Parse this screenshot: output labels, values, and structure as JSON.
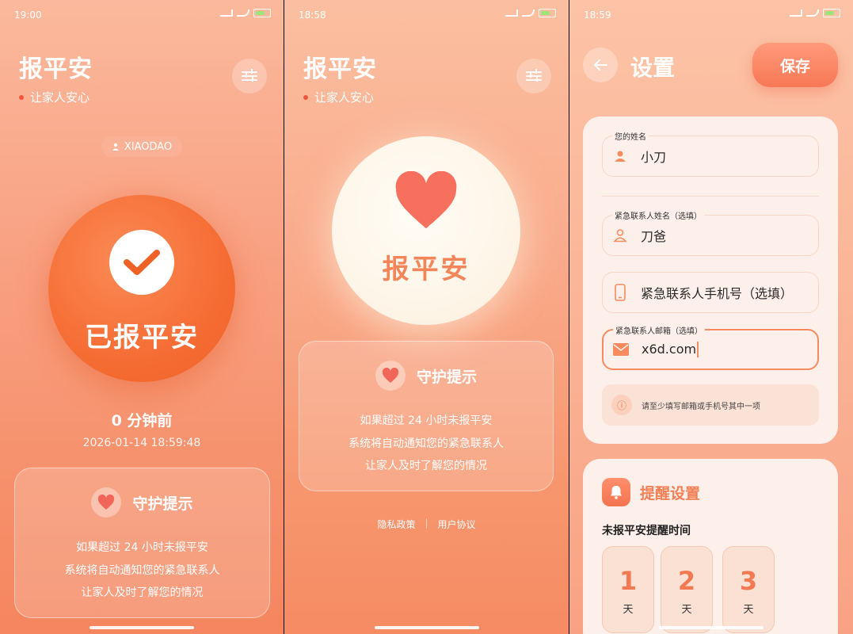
{
  "colors": {
    "accent": "#f56d34",
    "brand_text": "#f2855a",
    "heart": "#f2665a",
    "card_bg": "#fdf0ea"
  },
  "screen1": {
    "status_time": "19:00",
    "battery": "50",
    "app_title": "报平安",
    "app_subtitle": "让家人安心",
    "username": "XIAODAO",
    "button_label": "已报平安",
    "ago": "0 分钟前",
    "timestamp": "2026-01-14 18:59:48",
    "guard": {
      "title": "守护提示",
      "lines": [
        "如果超过 24 小时未报平安",
        "系统将自动通知您的紧急联系人",
        "让家人及时了解您的情况"
      ]
    }
  },
  "screen2": {
    "status_time": "18:58",
    "battery": "50",
    "app_title": "报平安",
    "app_subtitle": "让家人安心",
    "button_label": "报平安",
    "guard": {
      "title": "守护提示",
      "lines": [
        "如果超过 24 小时未报平安",
        "系统将自动通知您的紧急联系人",
        "让家人及时了解您的情况"
      ]
    },
    "footer": {
      "privacy": "隐私政策",
      "separator": "|",
      "terms": "用户协议"
    }
  },
  "screen3": {
    "status_time": "18:59",
    "battery": "50",
    "title": "设置",
    "save_label": "保存",
    "fields": {
      "name_legend": "您的姓名",
      "name_value": "小刀",
      "contact_name_legend": "紧急联系人姓名（选填）",
      "contact_name_value": "刀爸",
      "phone_placeholder": "紧急联系人手机号（选填）",
      "email_legend": "紧急联系人邮箱（选填）",
      "email_value": "x6d.com"
    },
    "hint": "请至少填写邮箱或手机号其中一项",
    "remind": {
      "title": "提醒设置",
      "subtitle": "未报平安提醒时间",
      "options": [
        {
          "num": "1",
          "unit": "天"
        },
        {
          "num": "2",
          "unit": "天"
        },
        {
          "num": "3",
          "unit": "天"
        }
      ]
    }
  }
}
